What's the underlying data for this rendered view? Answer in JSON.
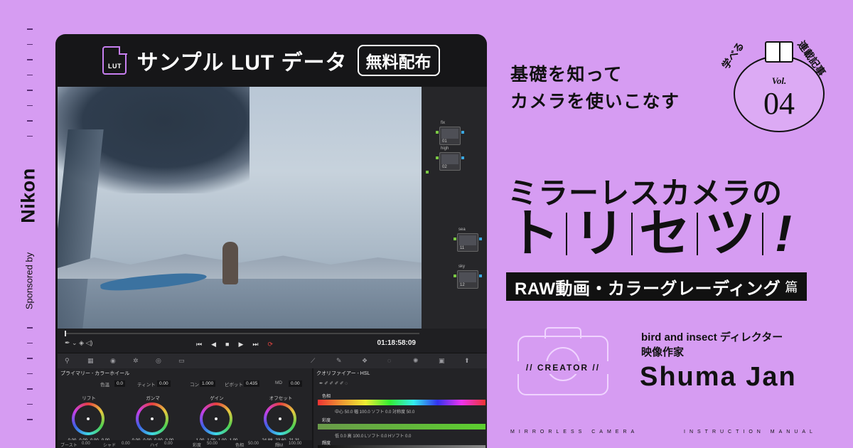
{
  "sponsor": {
    "label": "Sponsored by",
    "brand": "Nikon"
  },
  "app": {
    "icon_label": "LUT",
    "header_title": "サンプル LUT データ",
    "header_badge": "無料配布",
    "viewer": {
      "timecode": "01:18:58:09"
    },
    "nodes": [
      {
        "name": "fix",
        "id": "01"
      },
      {
        "name": "high",
        "id": "02"
      },
      {
        "name": "sea",
        "id": "11"
      },
      {
        "name": "sky",
        "id": "12"
      }
    ],
    "primary_panel": {
      "title": "プライマリー - カラーホイール",
      "params": [
        {
          "label": "色温",
          "value": "0.0"
        },
        {
          "label": "ティント",
          "value": "0.00"
        },
        {
          "label": "コン",
          "value": "1.000"
        },
        {
          "label": "ピボット",
          "value": "0.435"
        },
        {
          "label": "MD",
          "value": "0.00"
        }
      ],
      "wheels": [
        {
          "name": "リフト",
          "values": [
            "0.00",
            "0.00",
            "0.00",
            "0.00"
          ]
        },
        {
          "name": "ガンマ",
          "values": [
            "0.00",
            "0.00",
            "0.00",
            "0.00"
          ]
        },
        {
          "name": "ゲイン",
          "values": [
            "1.00",
            "1.00",
            "1.00",
            "1.00"
          ]
        },
        {
          "name": "オフセット",
          "values": [
            "24.88",
            "23.60",
            "21.31"
          ]
        }
      ],
      "bottom": [
        {
          "label": "ブースト",
          "value": "0.00"
        },
        {
          "label": "シャド",
          "value": "0.00"
        },
        {
          "label": "ハイ",
          "value": "0.00"
        },
        {
          "label": "彩度",
          "value": "50.00"
        },
        {
          "label": "色相",
          "value": "50.00"
        },
        {
          "label": "輝M",
          "value": "100.00"
        }
      ]
    },
    "hsl_panel": {
      "title": "クオリファイアー - HSL",
      "rows": [
        {
          "label": "色相",
          "nums": "中心 50.0  幅 100.0  ソフト 0.0  対称度 50.0"
        },
        {
          "label": "彩度",
          "nums": "低 0.0  高 100.0  Lソフト 0.0  Hソフト 0.0"
        },
        {
          "label": "輝度",
          "nums": "低 0.0  高 100.0  Lソフト 0.0  Hソフト 0.0"
        }
      ]
    }
  },
  "copy": {
    "lead_line1": "基礎を知って",
    "lead_line2": "カメラを使いこなす",
    "title_line1": "ミラーレスカメラの",
    "title_chars": [
      "ト",
      "リ",
      "セ",
      "ツ"
    ],
    "title_bang": "!",
    "edition_main": "RAW動画・カラーグレーディング",
    "edition_suffix": "篇"
  },
  "badge": {
    "left": "学べる",
    "right": "連載記事",
    "tag": "Vol.",
    "number": "04"
  },
  "creator": {
    "label": "// CREATOR //",
    "role1": "bird and insect ディレクター",
    "role2": "映像作家",
    "name": "Shuma Jan"
  },
  "footer": {
    "left": "MIRRORLESS CAMERA",
    "right": "INSTRUCTION MANUAL"
  },
  "colors": {
    "background": "#d69cf2",
    "accent": "#c77ff0",
    "ink": "#111111"
  }
}
